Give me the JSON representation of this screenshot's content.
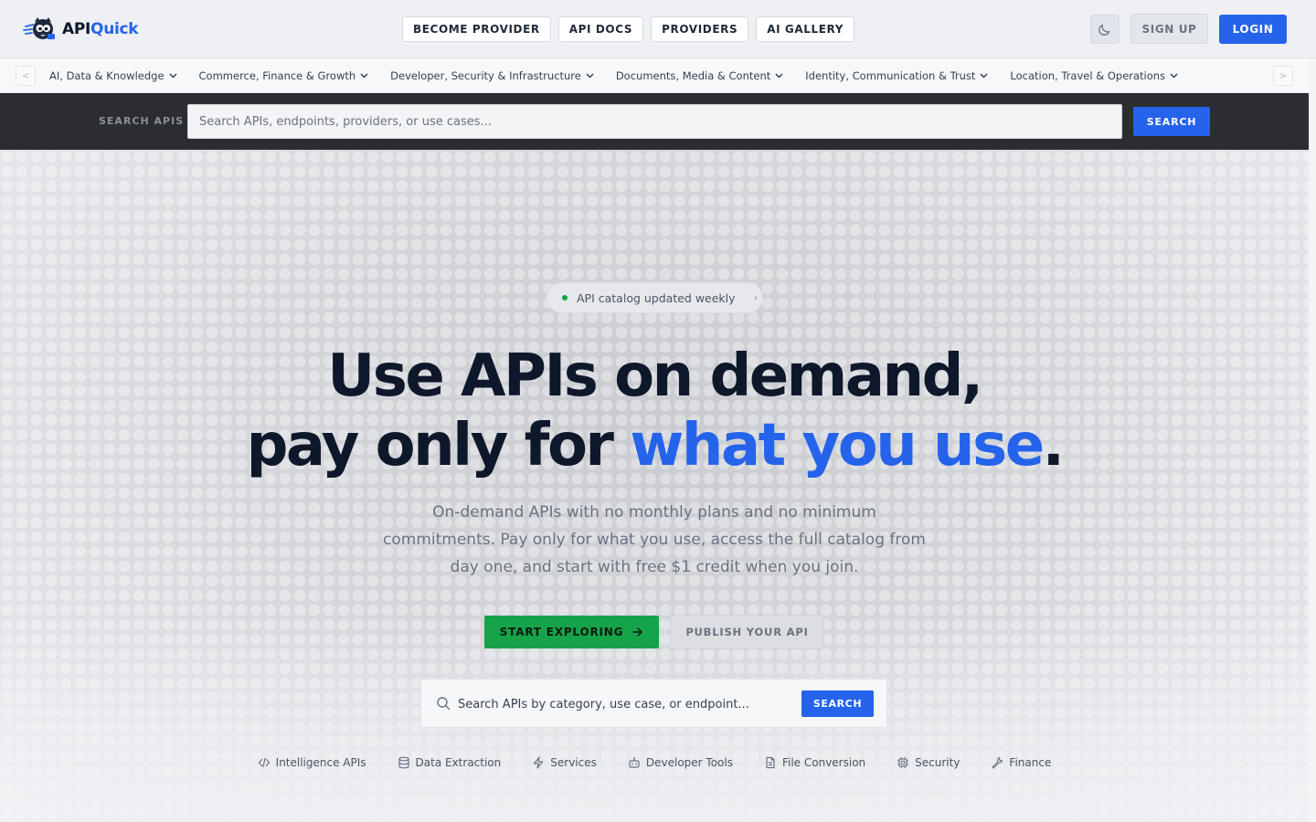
{
  "brand": {
    "name_part1": "API",
    "name_part2": "Quick"
  },
  "topnav": {
    "items": [
      "BECOME PROVIDER",
      "API DOCS",
      "PROVIDERS",
      "AI GALLERY"
    ],
    "signup": "SIGN UP",
    "login": "LOGIN"
  },
  "categories": {
    "prev": "<",
    "next": ">",
    "items": [
      "AI, Data & Knowledge",
      "Commerce, Finance & Growth",
      "Developer, Security & Infrastructure",
      "Documents, Media & Content",
      "Identity, Communication & Trust",
      "Location, Travel & Operations"
    ]
  },
  "searchstrip": {
    "label": "SEARCH APIS",
    "placeholder": "Search APIs, endpoints, providers, or use cases...",
    "button": "SEARCH"
  },
  "hero": {
    "badge": "API catalog updated weekly",
    "headline_line1": "Use APIs on demand,",
    "headline_line2_prefix": "pay only for ",
    "headline_line2_accent": "what you use",
    "headline_line2_suffix": ".",
    "subhead": "On-demand APIs with no monthly plans and no minimum commitments. Pay only for what you use, access the full catalog from day one, and start with free $1 credit when you join.",
    "cta_primary": "START EXPLORING",
    "cta_secondary": "PUBLISH YOUR API",
    "search_placeholder": "Search APIs by category, use case, or endpoint...",
    "search_button": "SEARCH"
  },
  "quicklinks": [
    {
      "label": "Intelligence APIs",
      "icon": "code-icon"
    },
    {
      "label": "Data Extraction",
      "icon": "database-icon"
    },
    {
      "label": "Services",
      "icon": "lightning-icon"
    },
    {
      "label": "Developer Tools",
      "icon": "robot-icon"
    },
    {
      "label": "File Conversion",
      "icon": "file-icon"
    },
    {
      "label": "Security",
      "icon": "chip-icon"
    },
    {
      "label": "Finance",
      "icon": "wrench-icon"
    }
  ],
  "colors": {
    "accent": "#2563eb",
    "success": "#16a34a",
    "dark_strip": "#2b2d31"
  }
}
